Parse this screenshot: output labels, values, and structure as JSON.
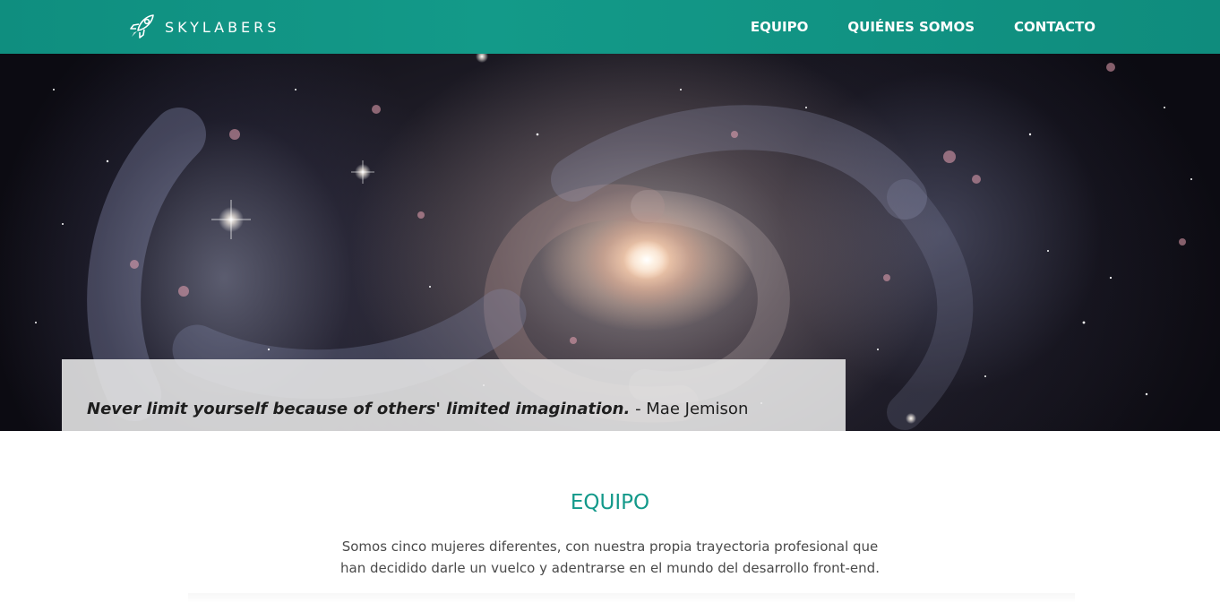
{
  "brand": {
    "name": "SKYLABERS",
    "logo_icon": "rocket-icon"
  },
  "nav": {
    "items": [
      {
        "label": "EQUIPO"
      },
      {
        "label": "QUIÉNES SOMOS"
      },
      {
        "label": "CONTACTO"
      }
    ]
  },
  "hero": {
    "quote": "Never limit yourself because of others' limited imagination.",
    "author": "- Mae Jemison"
  },
  "section": {
    "title": "EQUIPO",
    "text": "Somos cinco mujeres diferentes, con nuestra propia trayectoria profesional que han decidido darle un vuelco y adentrarse en el mundo del desarrollo front-end."
  },
  "colors": {
    "accent": "#13998a",
    "navbar": "#139a89",
    "quote_bg": "#e8e8e8"
  }
}
